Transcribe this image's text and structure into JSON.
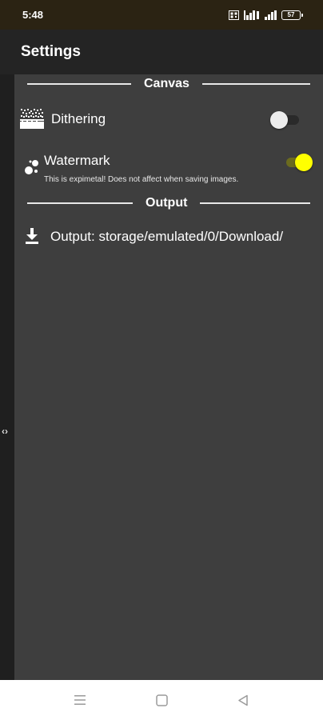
{
  "status_bar": {
    "time": "5:48",
    "battery": "57"
  },
  "app_bar": {
    "title": "Settings"
  },
  "sections": {
    "canvas": {
      "title": "Canvas"
    },
    "output": {
      "title": "Output"
    }
  },
  "settings": {
    "dithering": {
      "label": "Dithering",
      "icon": "dithering-icon",
      "enabled": false
    },
    "watermark": {
      "label": "Watermark",
      "sublabel": "This is expimetal! Does not affect when saving images.",
      "icon": "bubbles-icon",
      "enabled": true
    },
    "output": {
      "label": "Output: storage/emulated/0/Download/",
      "icon": "download-icon"
    }
  },
  "side_handle": {
    "glyph": "‹›"
  },
  "colors": {
    "accent": "#ffff00",
    "panel": "#3e3e3e",
    "app_bar": "#242424",
    "status_bar": "#2b2313"
  }
}
